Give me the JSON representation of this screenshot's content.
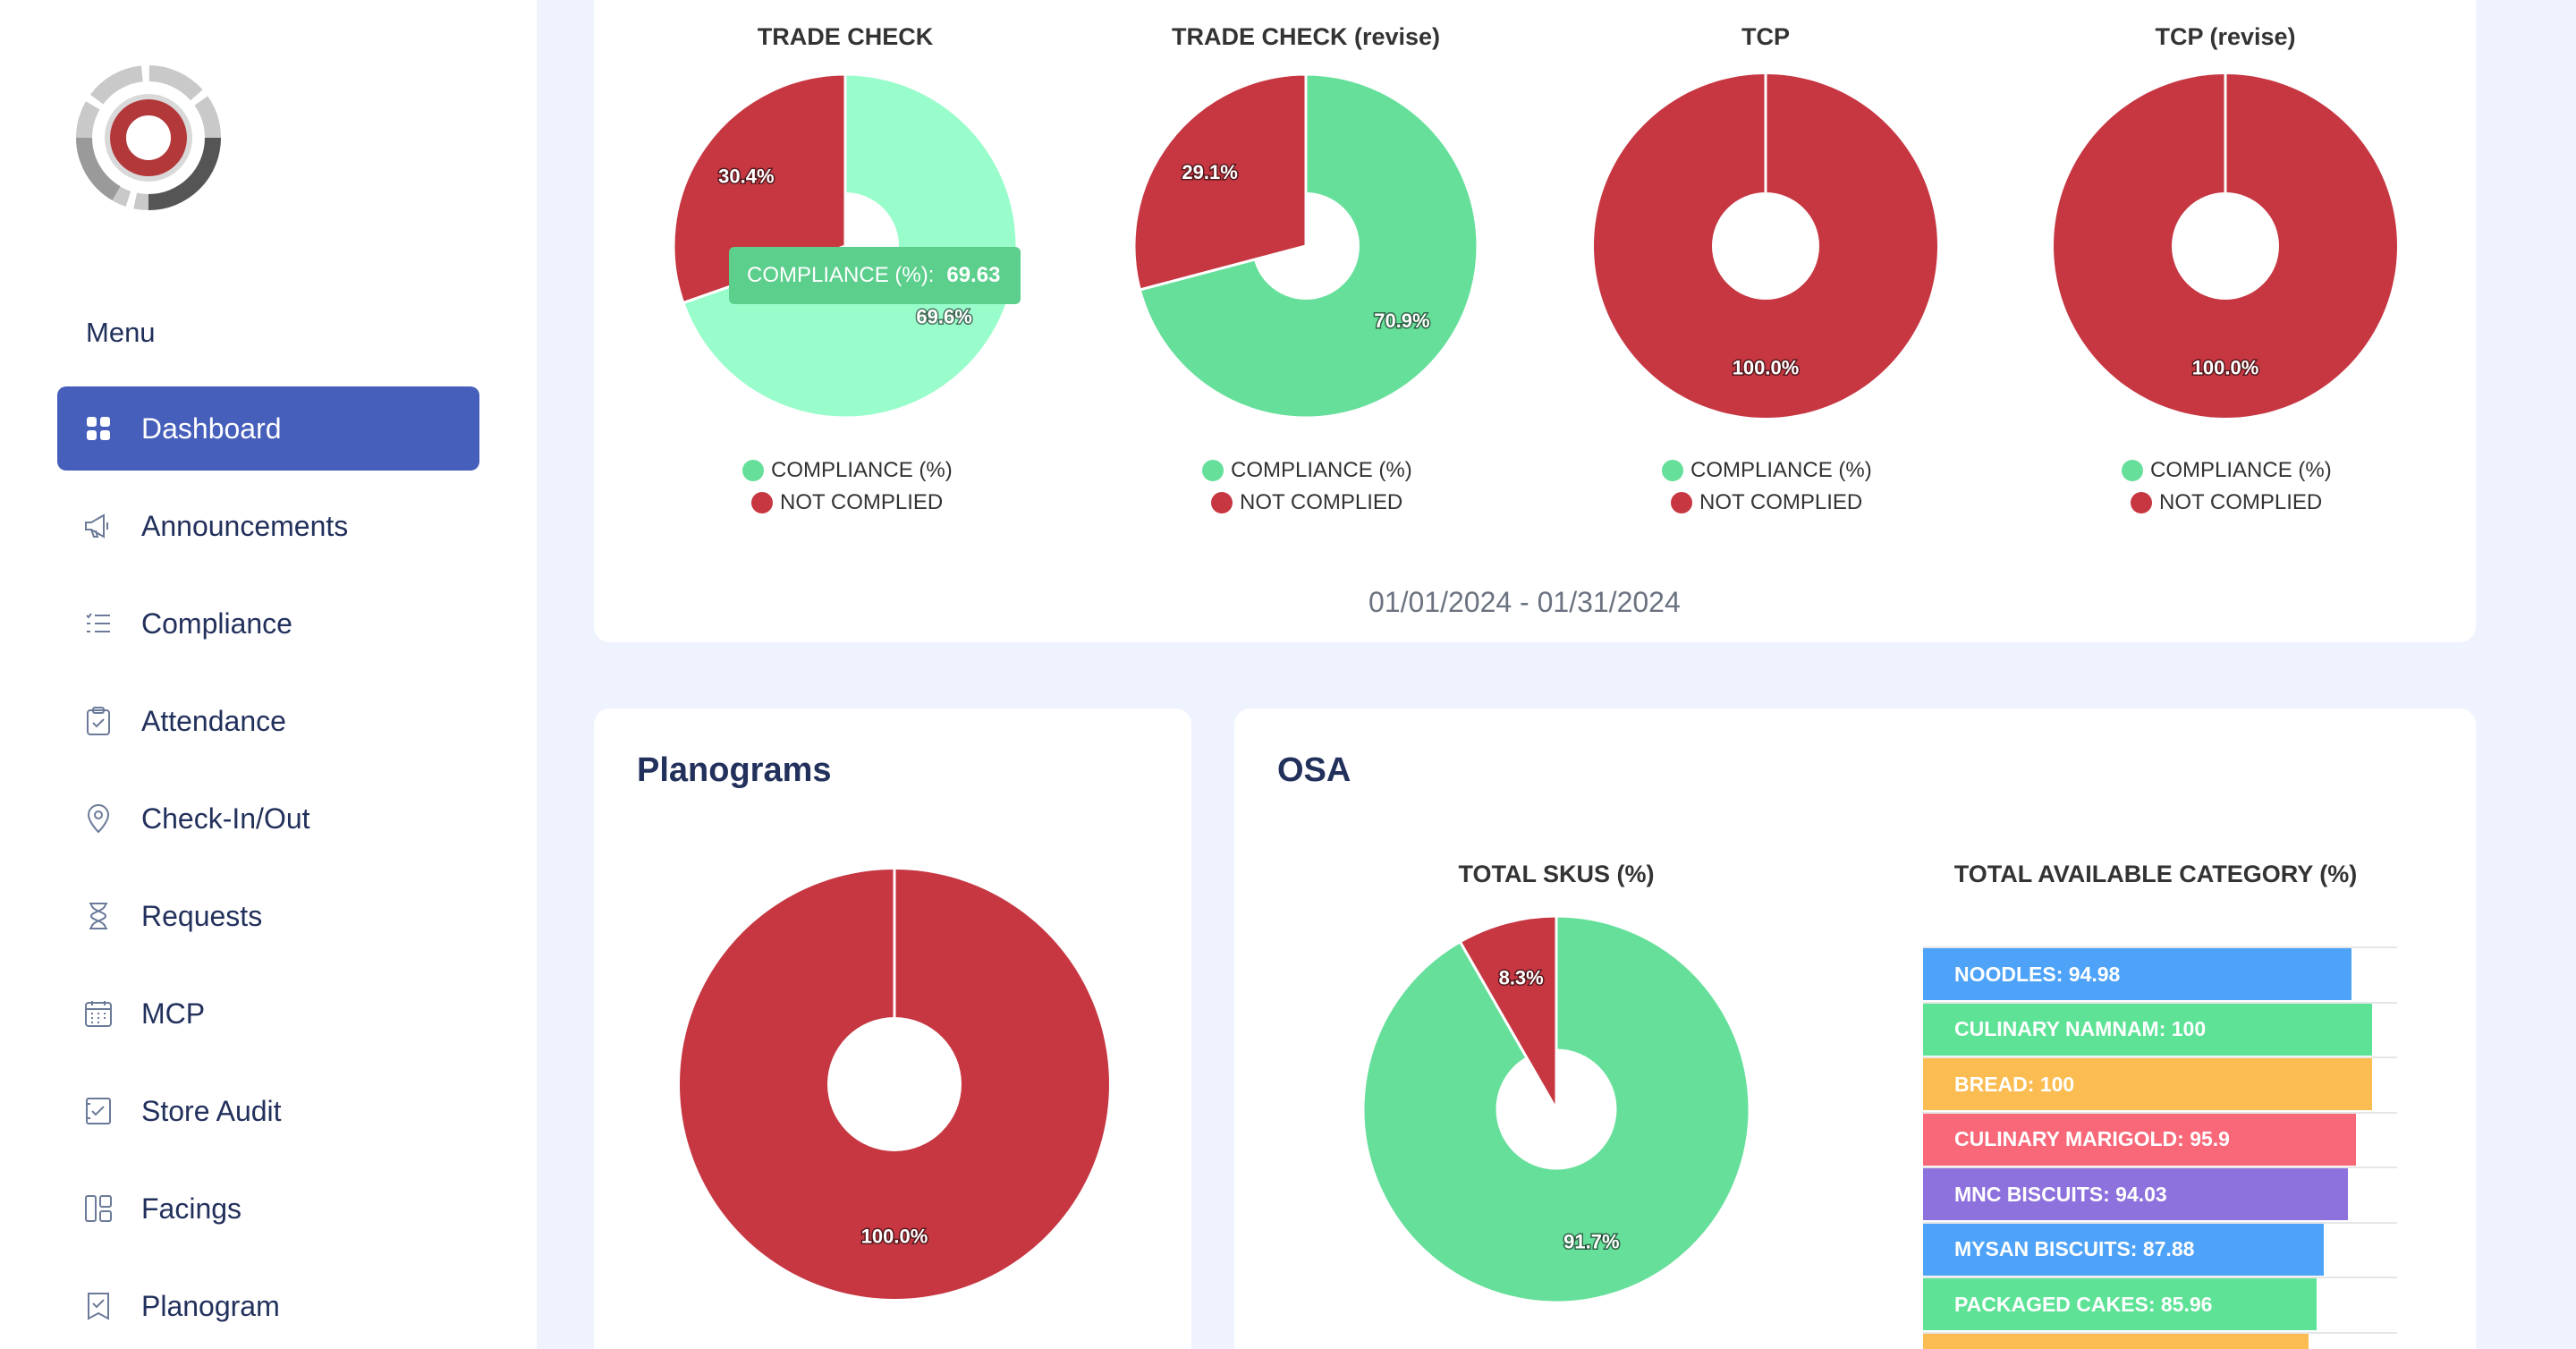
{
  "sidebar": {
    "menu_title": "Menu",
    "items": [
      {
        "label": "Dashboard",
        "icon": "grid-icon",
        "active": true
      },
      {
        "label": "Announcements",
        "icon": "megaphone-icon"
      },
      {
        "label": "Compliance",
        "icon": "checklist-icon"
      },
      {
        "label": "Attendance",
        "icon": "clipboard-check-icon"
      },
      {
        "label": "Check-In/Out",
        "icon": "location-pin-icon"
      },
      {
        "label": "Requests",
        "icon": "hourglass-icon"
      },
      {
        "label": "MCP",
        "icon": "calendar-icon"
      },
      {
        "label": "Store Audit",
        "icon": "audit-check-icon"
      },
      {
        "label": "Facings",
        "icon": "layout-icon"
      },
      {
        "label": "Planogram",
        "icon": "bookmark-check-icon"
      }
    ]
  },
  "colors": {
    "compliance_light": "#99fdcb",
    "compliance": "#66df9a",
    "not_complied": "#c63742",
    "active_nav": "#465fbb"
  },
  "top_card": {
    "date_range": "01/01/2024 - 01/31/2024",
    "legend": {
      "compliance": "COMPLIANCE (%)",
      "not_complied": "NOT COMPLIED"
    },
    "tooltip": {
      "label": "COMPLIANCE (%):",
      "value": "69.63"
    }
  },
  "planograms": {
    "heading": "Planograms"
  },
  "osa": {
    "heading": "OSA"
  },
  "chart_data": [
    {
      "type": "pie",
      "title": "TRADE CHECK",
      "labels": [
        "COMPLIANCE (%)",
        "NOT COMPLIED"
      ],
      "values": [
        69.63,
        30.37
      ],
      "slice_labels": [
        "69.6%",
        "30.4%"
      ]
    },
    {
      "type": "pie",
      "title": "TRADE CHECK (revise)",
      "labels": [
        "COMPLIANCE (%)",
        "NOT COMPLIED"
      ],
      "values": [
        70.9,
        29.1
      ],
      "slice_labels": [
        "70.9%",
        "29.1%"
      ]
    },
    {
      "type": "pie",
      "title": "TCP",
      "labels": [
        "COMPLIANCE (%)",
        "NOT COMPLIED"
      ],
      "values": [
        0,
        100
      ],
      "slice_labels": [
        "",
        "100.0%"
      ]
    },
    {
      "type": "pie",
      "title": "TCP (revise)",
      "labels": [
        "COMPLIANCE (%)",
        "NOT COMPLIED"
      ],
      "values": [
        0,
        100
      ],
      "slice_labels": [
        "",
        "100.0%"
      ]
    },
    {
      "type": "pie",
      "title": "",
      "labels": [
        "COMPLIANCE (%)",
        "NOT COMPLIED"
      ],
      "values": [
        0,
        100
      ],
      "slice_labels": [
        "",
        "100.0%"
      ]
    },
    {
      "type": "pie",
      "title": "TOTAL SKUS (%)",
      "labels": [
        "COMPLIANCE (%)",
        "NOT COMPLIED"
      ],
      "values": [
        91.7,
        8.3
      ],
      "slice_labels": [
        "91.7%",
        "8.3%"
      ]
    },
    {
      "type": "bar",
      "title": "TOTAL AVAILABLE CATEGORY (%)",
      "orientation": "horizontal",
      "xlim": [
        0,
        120
      ],
      "categories": [
        "NOODLES",
        "CULINARY NAMNAM",
        "BREAD",
        "CULINARY MARIGOLD",
        "MNC BISCUITS",
        "MYSAN BISCUITS",
        "PACKAGED CAKES",
        ""
      ],
      "values": [
        94.98,
        100,
        100,
        95.9,
        94.03,
        87.88,
        85.96,
        84
      ],
      "bar_labels": [
        "NOODLES: 94.98",
        "CULINARY NAMNAM: 100",
        "BREAD: 100",
        "CULINARY MARIGOLD: 95.9",
        "MNC BISCUITS: 94.03",
        "MYSAN BISCUITS: 87.88",
        "PACKAGED CAKES: 85.96",
        ""
      ],
      "colors": [
        "#55a2f0",
        "#66df9a",
        "#f6bd5c",
        "#ee6b7a",
        "#8c72d4",
        "#55a2f0",
        "#66df9a",
        "#f6bd5c"
      ]
    }
  ]
}
